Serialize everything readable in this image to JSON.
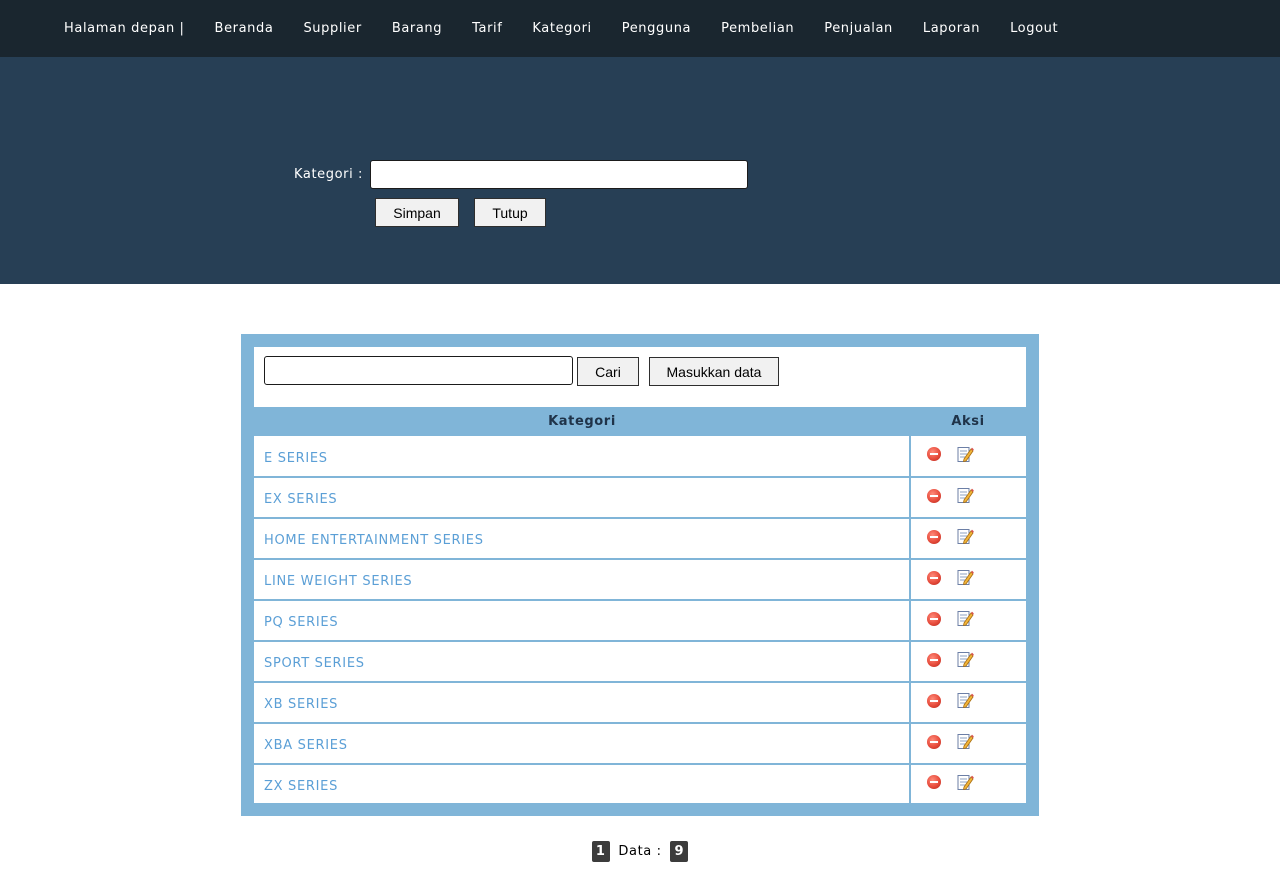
{
  "nav": {
    "items": [
      {
        "label": "Halaman depan |"
      },
      {
        "label": "Beranda"
      },
      {
        "label": "Supplier"
      },
      {
        "label": "Barang"
      },
      {
        "label": "Tarif"
      },
      {
        "label": "Kategori"
      },
      {
        "label": "Pengguna"
      },
      {
        "label": "Pembelian"
      },
      {
        "label": "Penjualan"
      },
      {
        "label": "Laporan"
      },
      {
        "label": "Logout"
      }
    ]
  },
  "form": {
    "label": "Kategori :",
    "value": "",
    "save_label": "Simpan",
    "close_label": "Tutup"
  },
  "search": {
    "value": "",
    "search_label": "Cari",
    "add_label": "Masukkan data"
  },
  "table": {
    "columns": [
      "Kategori",
      "Aksi"
    ],
    "rows": [
      "E SERIES",
      "EX SERIES",
      "HOME ENTERTAINMENT SERIES",
      "LINE WEIGHT SERIES",
      "PQ SERIES",
      "SPORT SERIES",
      "XB SERIES",
      "XBA SERIES",
      "ZX SERIES"
    ]
  },
  "pager": {
    "current_page": "1",
    "label": "Data :",
    "total": "9"
  }
}
